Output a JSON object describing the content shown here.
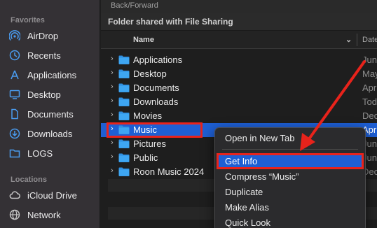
{
  "sidebar": {
    "favorites_heading": "Favorites",
    "locations_heading": "Locations",
    "favorites": [
      {
        "label": "AirDrop",
        "icon": "airdrop-icon"
      },
      {
        "label": "Recents",
        "icon": "clock-icon"
      },
      {
        "label": "Applications",
        "icon": "applications-icon"
      },
      {
        "label": "Desktop",
        "icon": "desktop-icon"
      },
      {
        "label": "Documents",
        "icon": "document-icon"
      },
      {
        "label": "Downloads",
        "icon": "download-icon"
      },
      {
        "label": "LOGS",
        "icon": "folder-icon"
      }
    ],
    "locations": [
      {
        "label": "iCloud Drive",
        "icon": "cloud-icon"
      },
      {
        "label": "Network",
        "icon": "globe-icon"
      }
    ]
  },
  "toolbar": {
    "back_forward": "Back/Forward"
  },
  "path_bar": "Folder shared with File Sharing",
  "columns": {
    "name": "Name",
    "date": "Date"
  },
  "files": [
    {
      "name": "Applications",
      "date": "Jun"
    },
    {
      "name": "Desktop",
      "date": "May"
    },
    {
      "name": "Documents",
      "date": "Apr"
    },
    {
      "name": "Downloads",
      "date": "Tod"
    },
    {
      "name": "Movies",
      "date": "Dec"
    },
    {
      "name": "Music",
      "date": "Apr",
      "selected": true
    },
    {
      "name": "Pictures",
      "date": "Jun"
    },
    {
      "name": "Public",
      "date": "Jun"
    },
    {
      "name": "Roon Music 2024",
      "date": "Dec"
    }
  ],
  "context_menu": {
    "items": [
      {
        "label": "Open in New Tab"
      },
      {
        "label": "Get Info",
        "active": true
      },
      {
        "label": "Compress “Music”"
      },
      {
        "label": "Duplicate"
      },
      {
        "label": "Make Alias"
      },
      {
        "label": "Quick Look"
      }
    ]
  },
  "colors": {
    "accent": "#1e5fd4",
    "highlight_red": "#e8231b",
    "folder_blue": "#3ea6f2"
  }
}
